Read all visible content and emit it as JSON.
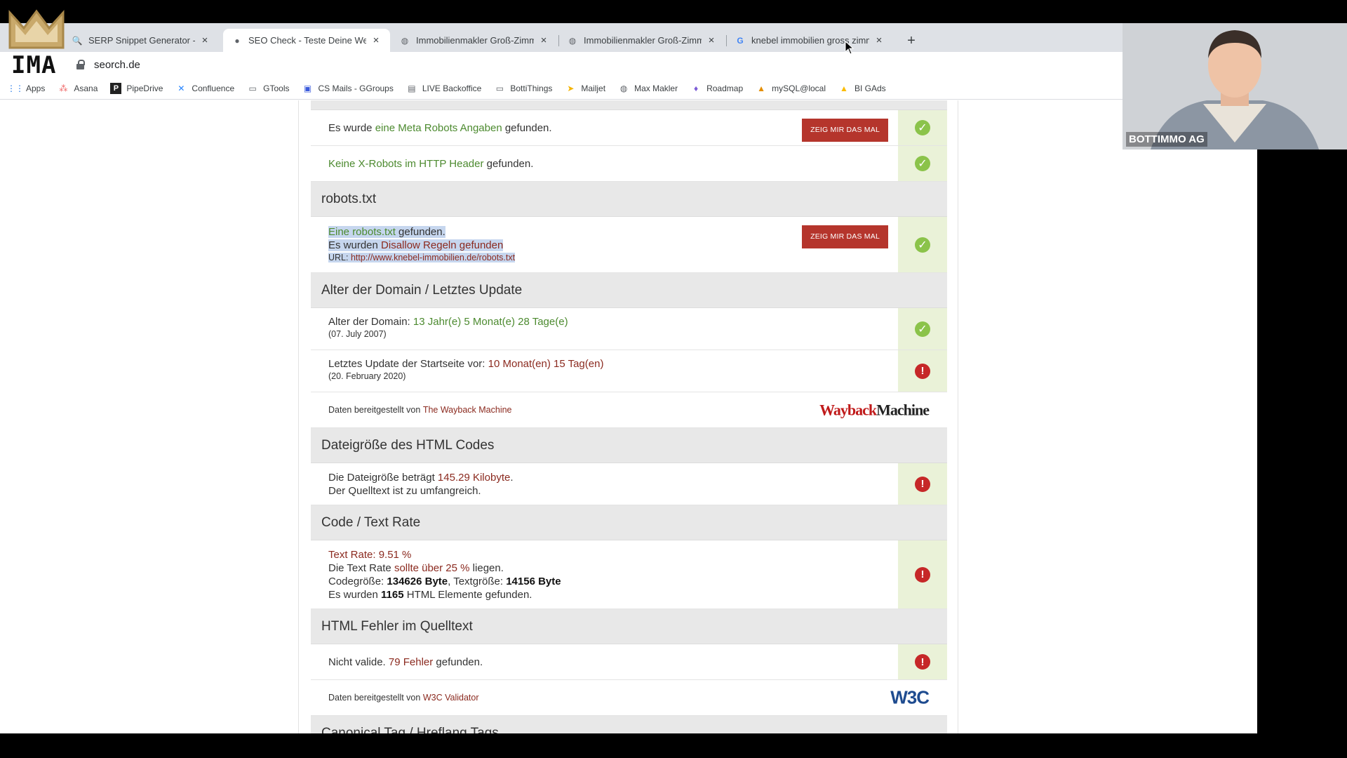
{
  "browser": {
    "tabs": [
      {
        "title": "SERP Snippet Generator - 🚀 F",
        "icon": "search-icon",
        "active": false
      },
      {
        "title": "SEO Check - Teste Deine Web",
        "icon": "seorch-icon",
        "active": true
      },
      {
        "title": "Immobilienmakler Groß-Zimm",
        "icon": "globe-icon",
        "active": false
      },
      {
        "title": "Immobilienmakler Groß-Zimm",
        "icon": "globe-icon",
        "active": false
      },
      {
        "title": "knebel immobilien gross zimm",
        "icon": "google-icon",
        "active": false
      }
    ],
    "url": "seorch.de",
    "bookmarks": [
      {
        "label": "Apps",
        "icon": "apps-grid-icon"
      },
      {
        "label": "Asana",
        "icon": "asana-icon"
      },
      {
        "label": "PipeDrive",
        "icon": "pipedrive-icon"
      },
      {
        "label": "Confluence",
        "icon": "confluence-icon"
      },
      {
        "label": "GTools",
        "icon": "folder-icon"
      },
      {
        "label": "CS Mails - GGroups",
        "icon": "mail-icon"
      },
      {
        "label": "LIVE Backoffice",
        "icon": "document-icon"
      },
      {
        "label": "BottiThings",
        "icon": "folder-icon"
      },
      {
        "label": "Mailjet",
        "icon": "mailjet-icon"
      },
      {
        "label": "Max Makler",
        "icon": "globe-icon"
      },
      {
        "label": "Roadmap",
        "icon": "roadmap-icon"
      },
      {
        "label": "mySQL@local",
        "icon": "mysql-icon"
      },
      {
        "label": "BI GAds",
        "icon": "google-ads-icon"
      }
    ]
  },
  "logo": {
    "text": "IMA"
  },
  "webcam": {
    "name": "BOTTIMMO AG"
  },
  "seo": {
    "show_button": "ZEIG MIR DAS MAL",
    "meta_robots": {
      "pre": "Es wurde ",
      "hl": "eine Meta Robots Angaben",
      "post": " gefunden.",
      "status": "ok"
    },
    "x_robots": {
      "hl": "Keine X-Robots im HTTP Header",
      "post": " gefunden.",
      "status": "ok"
    },
    "robots_section": "robots.txt",
    "robots": {
      "line1_hl": "Eine robots.txt",
      "line1_post": " gefunden.",
      "line2_pre": "Es wurden ",
      "line2_hl": "Disallow Regeln gefunden",
      "url_label": "URL: ",
      "url": "http://www.knebel-immobilien.de/robots.txt",
      "status": "ok"
    },
    "domain_section": "Alter der Domain / Letztes Update",
    "domain_age": {
      "pre": "Alter der Domain: ",
      "hl": "13 Jahr(e) 5 Monat(e) 28 Tage(e)",
      "date": "(07. July 2007)",
      "status": "ok"
    },
    "last_update": {
      "pre": "Letztes Update der Startseite vor: ",
      "hl": "10 Monat(en) 15 Tag(en)",
      "date": "(20. February 2020)",
      "status": "error"
    },
    "wayback": {
      "pre": "Daten bereitgestellt von ",
      "link": "The Wayback Machine",
      "logo_a": "Wayback",
      "logo_b": "Machine"
    },
    "filesize_section": "Dateigröße des HTML Codes",
    "filesize": {
      "pre": "Die Dateigröße beträgt ",
      "hl": "145.29 Kilobyte",
      "post": ".",
      "line2": "Der Quelltext ist zu umfangreich.",
      "status": "error"
    },
    "textrate_section": "Code / Text Rate",
    "textrate": {
      "line1": "Text Rate: 9.51 %",
      "line2_pre": "Die Text Rate ",
      "line2_hl": "sollte über 25 %",
      "line2_post": " liegen.",
      "line3_pre": "Codegröße: ",
      "code_size": "134626 Byte",
      "line3_mid": ", Textgröße: ",
      "text_size": "14156 Byte",
      "line4_pre": "Es wurden ",
      "elements": "1165",
      "line4_post": " HTML Elemente gefunden.",
      "status": "error"
    },
    "htmlerr_section": "HTML Fehler im Quelltext",
    "htmlerr": {
      "pre": "Nicht valide. ",
      "hl": "79 Fehler",
      "post": " gefunden.",
      "status": "error"
    },
    "w3c": {
      "pre": "Daten bereitgestellt von ",
      "link": "W3C Validator",
      "logo": "W3C"
    },
    "canonical_section": "Canonical Tag / Hreflang Tags"
  },
  "colors": {
    "ok_green": "#8bc34a",
    "error_red": "#c62828",
    "button_red": "#b5352c",
    "status_bg": "#eaf2d8"
  }
}
